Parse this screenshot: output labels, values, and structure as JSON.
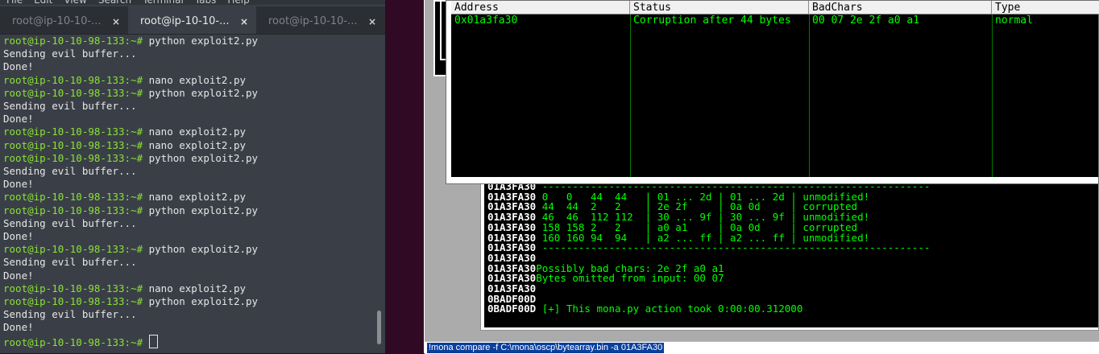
{
  "terminal": {
    "menu": [
      "File",
      "Edit",
      "View",
      "Search",
      "Terminal",
      "Tabs",
      "Help"
    ],
    "tabs": [
      {
        "label": "root@ip-10-10-...",
        "active": false
      },
      {
        "label": "root@ip-10-10-...",
        "active": true
      },
      {
        "label": "root@ip-10-10-...",
        "active": false
      }
    ],
    "close_glyph": "×",
    "prompt": "root@ip-10-10-98-133:~#",
    "lines": [
      {
        "type": "cmd",
        "text": " python exploit2.py"
      },
      {
        "type": "out",
        "text": "Sending evil buffer..."
      },
      {
        "type": "out",
        "text": "Done!"
      },
      {
        "type": "cmd",
        "text": " nano exploit2.py"
      },
      {
        "type": "cmd",
        "text": " python exploit2.py"
      },
      {
        "type": "out",
        "text": "Sending evil buffer..."
      },
      {
        "type": "out",
        "text": "Done!"
      },
      {
        "type": "cmd",
        "text": " nano exploit2.py"
      },
      {
        "type": "cmd",
        "text": " nano exploit2.py"
      },
      {
        "type": "cmd",
        "text": " python exploit2.py"
      },
      {
        "type": "out",
        "text": "Sending evil buffer..."
      },
      {
        "type": "out",
        "text": "Done!"
      },
      {
        "type": "cmd",
        "text": " nano exploit2.py"
      },
      {
        "type": "cmd",
        "text": " python exploit2.py"
      },
      {
        "type": "out",
        "text": "Sending evil buffer..."
      },
      {
        "type": "out",
        "text": "Done!"
      },
      {
        "type": "cmd",
        "text": " python exploit2.py"
      },
      {
        "type": "out",
        "text": "Sending evil buffer..."
      },
      {
        "type": "out",
        "text": "Done!"
      },
      {
        "type": "cmd",
        "text": " nano exploit2.py"
      },
      {
        "type": "cmd",
        "text": " python exploit2.py"
      },
      {
        "type": "out",
        "text": "Sending evil buffer..."
      },
      {
        "type": "out",
        "text": "Done!"
      },
      {
        "type": "cursor",
        "text": " "
      }
    ]
  },
  "mona_table": {
    "columns": [
      "Address",
      "Status",
      "BadChars",
      "Type"
    ],
    "rows": [
      {
        "address": "0x01a3fa30",
        "status": "Corruption after 44 bytes",
        "badchars": "00 07 2e 2f a0 a1",
        "type": "normal"
      }
    ]
  },
  "log": {
    "lines": [
      {
        "addr": "01A3FA30",
        "text": " ----------------------------------------------------------------"
      },
      {
        "addr": "01A3FA30",
        "text": " 0   0   44  44   | 01 ... 2d | 01 ... 2d | unmodified!"
      },
      {
        "addr": "01A3FA30",
        "text": " 44  44  2   2    | 2e 2f     | 0a 0d     | corrupted"
      },
      {
        "addr": "01A3FA30",
        "text": " 46  46  112 112  | 30 ... 9f | 30 ... 9f | unmodified!"
      },
      {
        "addr": "01A3FA30",
        "text": " 158 158 2   2    | a0 a1     | 0a 0d     | corrupted"
      },
      {
        "addr": "01A3FA30",
        "text": " 160 160 94  94   | a2 ... ff | a2 ... ff | unmodified!"
      },
      {
        "addr": "01A3FA30",
        "text": " ----------------------------------------------------------------"
      },
      {
        "addr": "01A3FA30",
        "text": ""
      },
      {
        "addr": "01A3FA30",
        "text": "Possibly bad chars: 2e 2f a0 a1"
      },
      {
        "addr": "01A3FA30",
        "text": "Bytes omitted from input: 00 07"
      },
      {
        "addr": "01A3FA30",
        "text": ""
      },
      {
        "addr": "0BADF00D",
        "text": ""
      },
      {
        "addr": "0BADF00D",
        "text": " [+] This mona.py action took 0:00:00.312000"
      }
    ]
  },
  "command_bar": {
    "value": "!mona compare -f C:\\mona\\oscp\\bytearray.bin -a 01A3FA30"
  }
}
